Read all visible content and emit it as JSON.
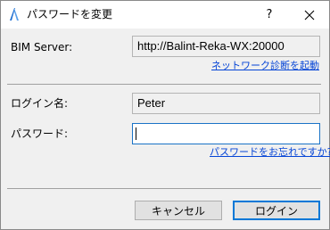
{
  "window": {
    "title": "パスワードを変更",
    "help_label": "?",
    "close_icon": "close-icon",
    "app_icon": "archicad-icon",
    "app_icon_color": "#1f6fd1"
  },
  "server": {
    "label": "BIM Server:",
    "value": "http://Balint-Reka-WX:20000",
    "diagnostics_link": "ネットワーク診断を起動"
  },
  "login": {
    "name_label": "ログイン名:",
    "name_value": "Peter",
    "password_label": "パスワード:",
    "password_value": "",
    "forgot_link": "パスワードをお忘れですか?"
  },
  "buttons": {
    "cancel": "キャンセル",
    "login": "ログイン"
  },
  "colors": {
    "link": "#0645d6",
    "focus_border": "#1a73c6"
  }
}
